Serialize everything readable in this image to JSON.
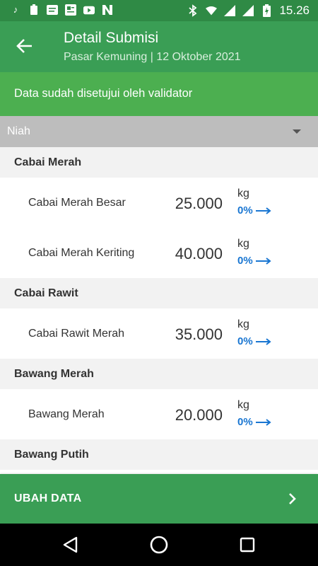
{
  "status_bar": {
    "time": "15.26",
    "icons_left": [
      "tiktok-icon",
      "clipboard-icon",
      "message-icon",
      "news-icon",
      "youtube-icon",
      "n-app-icon"
    ],
    "icons_right": [
      "bluetooth-icon",
      "wifi-icon",
      "signal-icon",
      "signal-icon",
      "battery-icon"
    ]
  },
  "app_bar": {
    "title": "Detail Submisi",
    "subtitle": "Pasar Kemuning | 12 Oktober 2021"
  },
  "banner": {
    "text": "Data sudah disetujui oleh validator"
  },
  "dropdown": {
    "selected": "Niah"
  },
  "categories": [
    {
      "name": "Cabai Merah",
      "items": [
        {
          "name": "Cabai Merah Besar",
          "qty": "25.000",
          "unit": "kg",
          "change": "0%"
        },
        {
          "name": "Cabai Merah Keriting",
          "qty": "40.000",
          "unit": "kg",
          "change": "0%"
        }
      ]
    },
    {
      "name": "Cabai Rawit",
      "items": [
        {
          "name": "Cabai Rawit Merah",
          "qty": "35.000",
          "unit": "kg",
          "change": "0%"
        }
      ]
    },
    {
      "name": "Bawang Merah",
      "items": [
        {
          "name": "Bawang Merah",
          "qty": "20.000",
          "unit": "kg",
          "change": "0%"
        }
      ]
    },
    {
      "name": "Bawang Putih",
      "items": []
    }
  ],
  "action_button": {
    "label": "UBAH DATA"
  },
  "colors": {
    "primary": "#3a9e55",
    "status": "#2f8a45",
    "banner": "#4caf50",
    "accent_blue": "#1976d2"
  }
}
